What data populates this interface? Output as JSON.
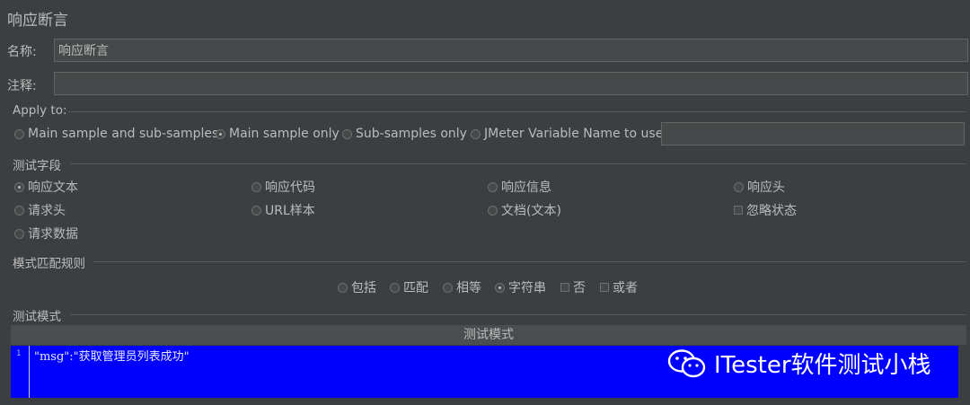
{
  "title": "响应断言",
  "name_label": "名称:",
  "name_value": "响应断言",
  "comment_label": "注释:",
  "comment_value": "",
  "apply_to": {
    "title": "Apply to:",
    "options": [
      "Main sample and sub-samples",
      "Main sample only",
      "Sub-samples only",
      "JMeter Variable Name to use"
    ],
    "selected": "Main sample only",
    "variable_value": ""
  },
  "test_field": {
    "title": "测试字段",
    "options": [
      "响应文本",
      "响应代码",
      "响应信息",
      "响应头",
      "请求头",
      "URL样本",
      "文档(文本)",
      "忽略状态",
      "请求数据"
    ],
    "selected": "响应文本"
  },
  "pattern_rules": {
    "title": "模式匹配规则",
    "options": [
      "包括",
      "匹配",
      "相等",
      "字符串",
      "否",
      "或者"
    ],
    "selected": "字符串"
  },
  "test_patterns": {
    "title": "测试模式",
    "column_header": "测试模式",
    "line_number": "1",
    "pattern": "\"msg\":\"获取管理员列表成功\""
  },
  "watermark": "ITester软件测试小栈"
}
